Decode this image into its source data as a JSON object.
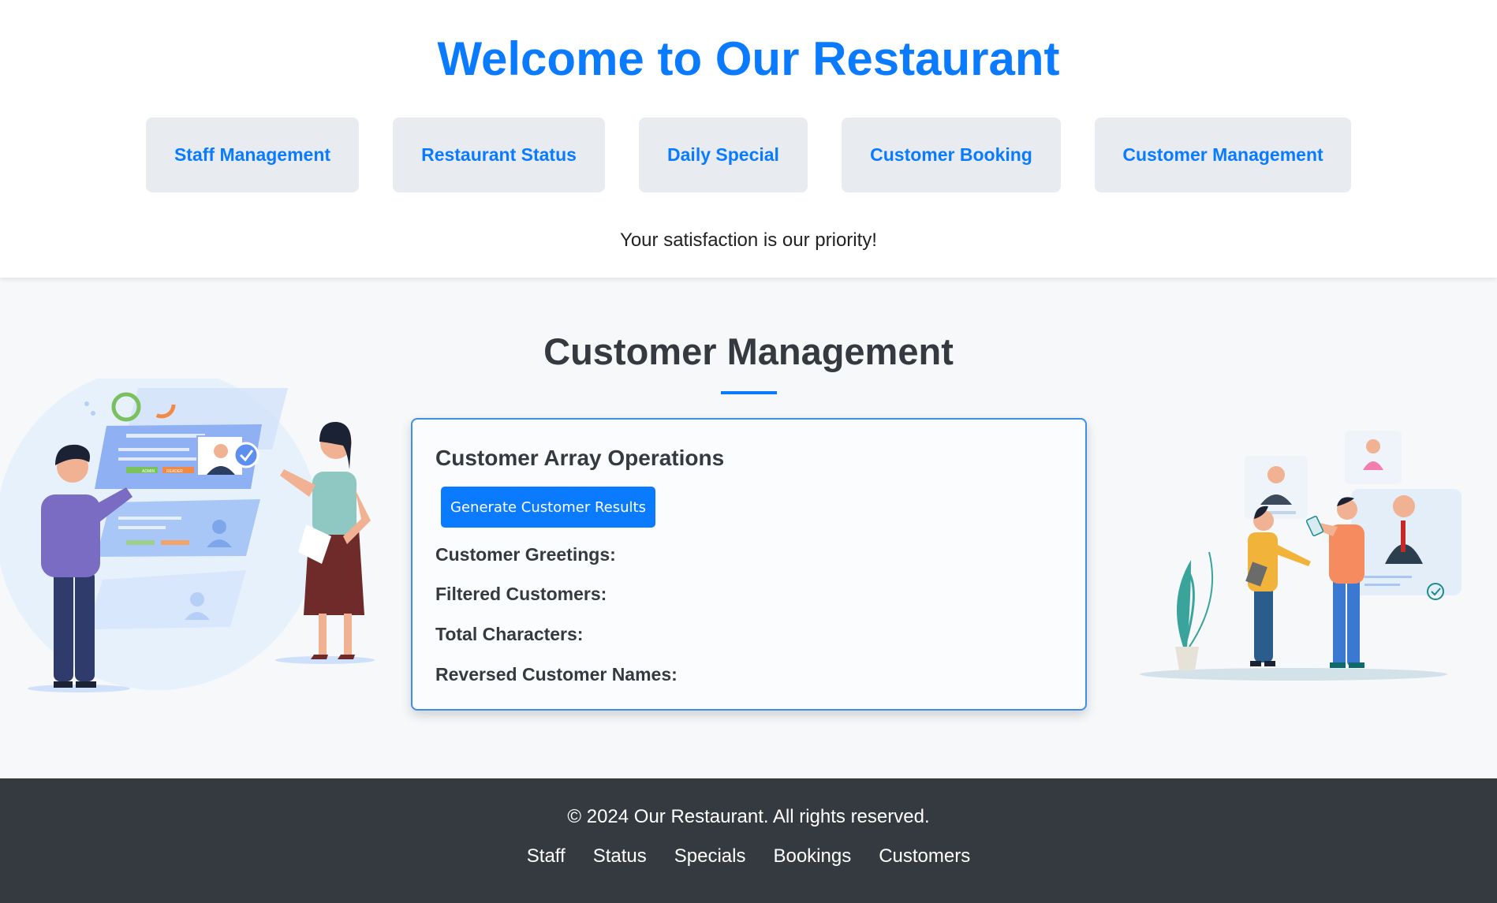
{
  "header": {
    "title": "Welcome to Our Restaurant",
    "tagline": "Your satisfaction is our priority!",
    "nav": [
      {
        "label": "Staff Management"
      },
      {
        "label": "Restaurant Status"
      },
      {
        "label": "Daily Special"
      },
      {
        "label": "Customer Booking"
      },
      {
        "label": "Customer Management"
      }
    ]
  },
  "main": {
    "section_title": "Customer Management",
    "card": {
      "title": "Customer Array Operations",
      "button_label": "Generate Customer Results",
      "results": [
        {
          "label": "Customer Greetings:"
        },
        {
          "label": "Filtered Customers:"
        },
        {
          "label": "Total Characters:"
        },
        {
          "label": "Reversed Customer Names:"
        }
      ]
    },
    "left_illustration": {
      "tags": [
        "ADMIN",
        "READER"
      ]
    }
  },
  "footer": {
    "copyright": "© 2024 Our Restaurant. All rights reserved.",
    "links": [
      {
        "label": "Staff"
      },
      {
        "label": "Status"
      },
      {
        "label": "Specials"
      },
      {
        "label": "Bookings"
      },
      {
        "label": "Customers"
      }
    ]
  },
  "colors": {
    "accent": "#0a7bff",
    "nav_bg": "#e8ecf0",
    "footer_bg": "#343a40",
    "page_bg": "#f6f8fa"
  }
}
